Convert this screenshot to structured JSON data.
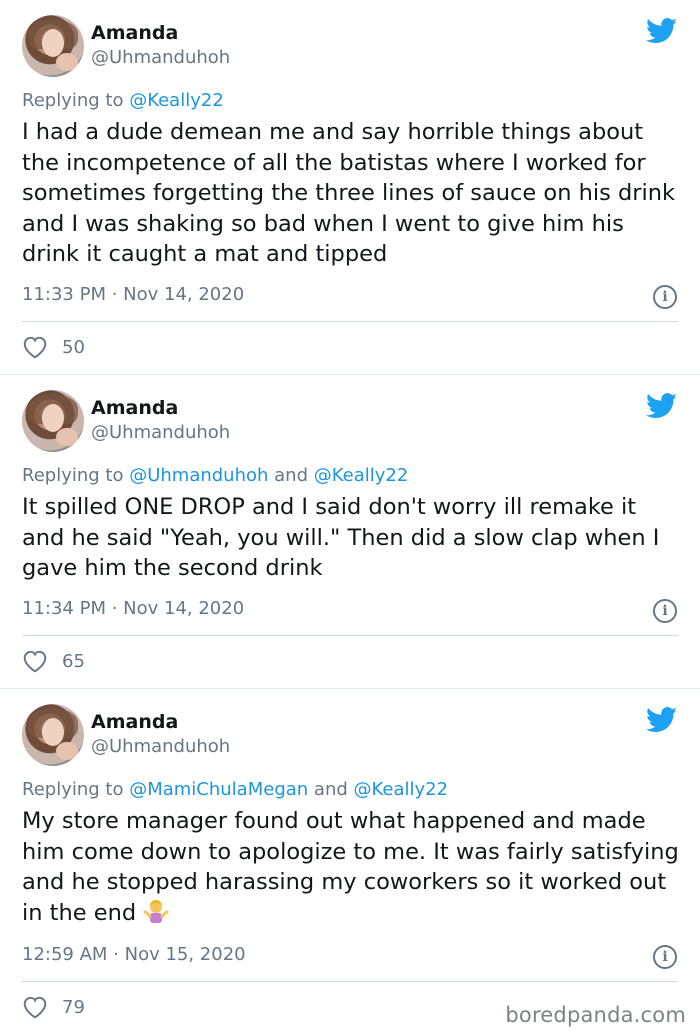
{
  "tweets": [
    {
      "name": "Amanda",
      "handle": "@Uhmanduhoh",
      "reply_prefix": "Replying to ",
      "reply_to": [
        "@Keally22"
      ],
      "text": "I had a dude demean me and say horrible things about the incompetence of all the batistas where I worked for sometimes forgetting the three lines of sauce on his drink and I was shaking so bad when I went to give him his drink it caught a mat and tipped",
      "timestamp": "11:33 PM · Nov 14, 2020",
      "likes": "50"
    },
    {
      "name": "Amanda",
      "handle": "@Uhmanduhoh",
      "reply_prefix": "Replying to ",
      "reply_to": [
        "@Uhmanduhoh",
        "@Keally22"
      ],
      "reply_joiner": " and ",
      "text": "It spilled ONE DROP and I said don't worry ill remake it and he said \"Yeah, you will.\" Then did a slow clap when I gave him the second drink",
      "timestamp": "11:34 PM · Nov 14, 2020",
      "likes": "65"
    },
    {
      "name": "Amanda",
      "handle": "@Uhmanduhoh",
      "reply_prefix": "Replying to ",
      "reply_to": [
        "@MamiChulaMegan",
        "@Keally22"
      ],
      "reply_joiner": " and ",
      "text": "My store manager found out what happened and made him come down to apologize to me. It was fairly satisfying and he stopped harassing my coworkers so it worked out in the end",
      "emoji": "woman-shrugging-emoji",
      "timestamp": "12:59 AM · Nov 15, 2020",
      "likes": "79"
    }
  ],
  "icons": {
    "brand": "twitter-bird-icon",
    "like": "heart-icon",
    "info": "info-icon"
  },
  "colors": {
    "twitter_blue": "#1da1f2",
    "mention_blue": "#1b95e0",
    "secondary_text": "#657786",
    "divider": "#ccd6dd"
  },
  "watermark": "boredpanda.com"
}
